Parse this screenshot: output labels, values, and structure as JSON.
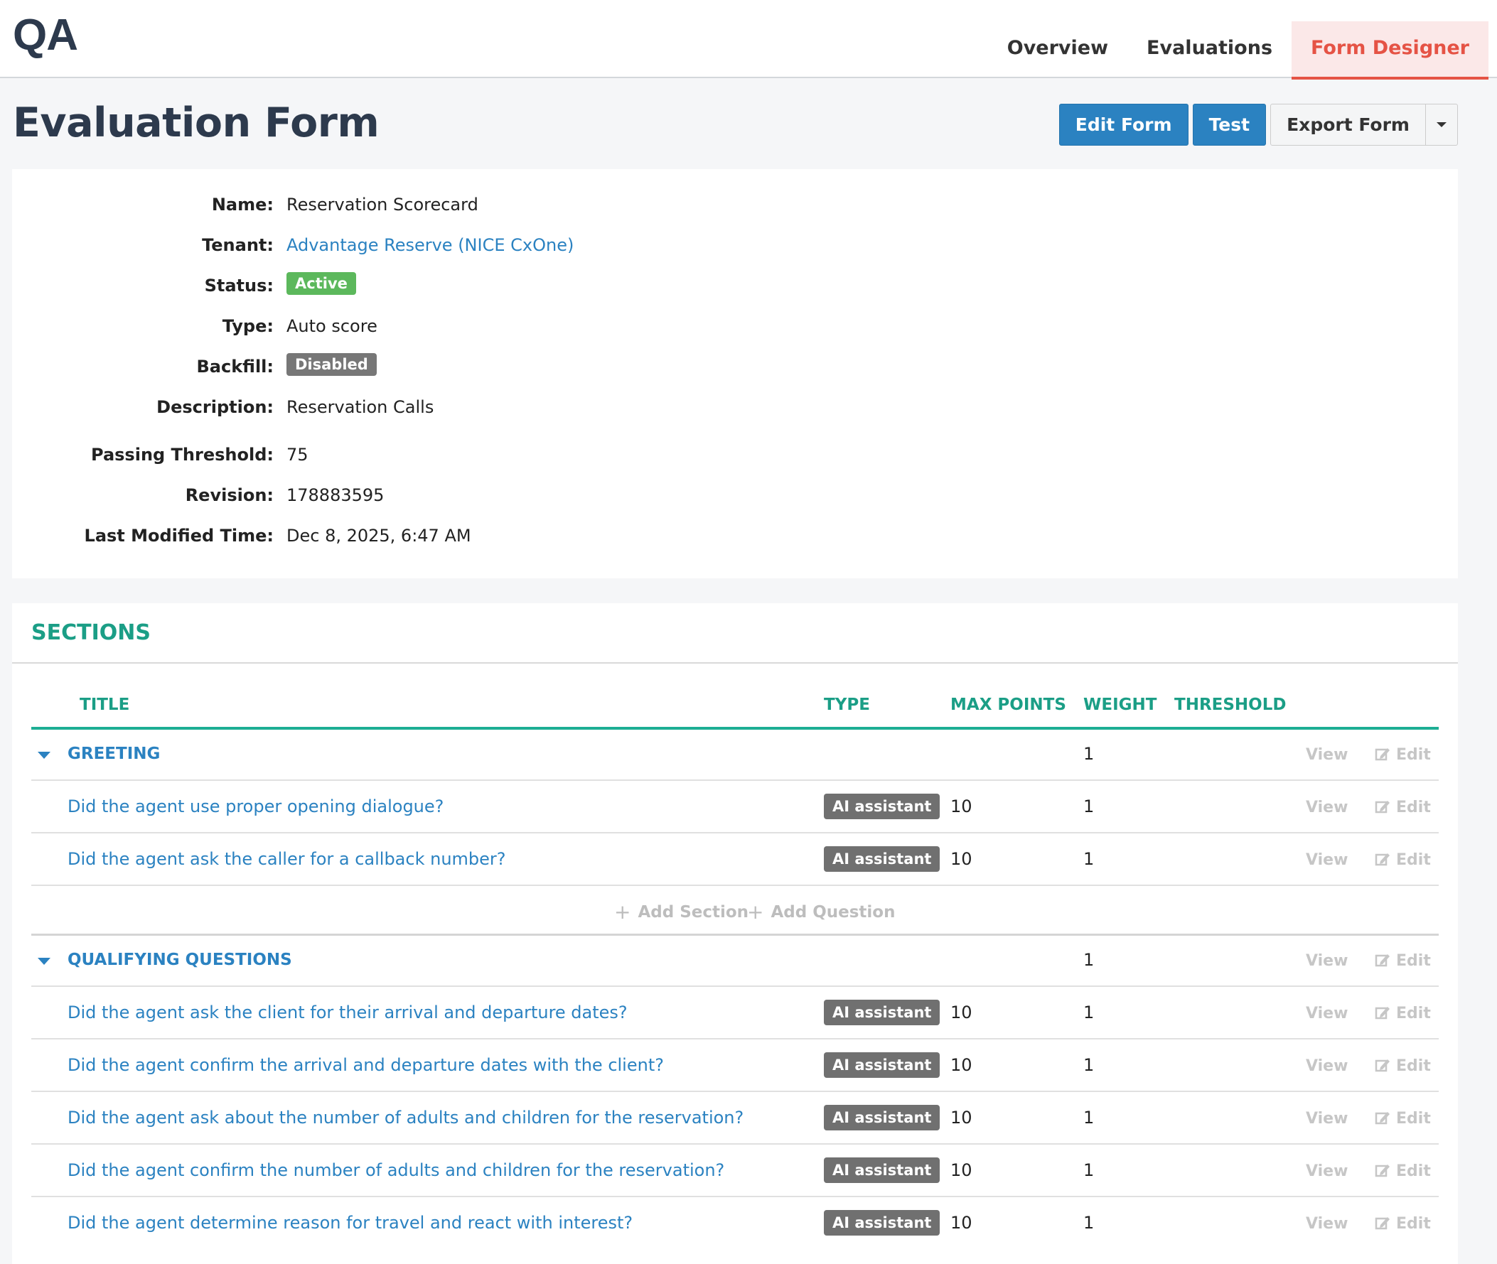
{
  "app": {
    "brand": "QA"
  },
  "nav": {
    "tabs": [
      {
        "label": "Overview"
      },
      {
        "label": "Evaluations"
      },
      {
        "label": "Form Designer"
      }
    ]
  },
  "page": {
    "title": "Evaluation Form"
  },
  "toolbar": {
    "edit_label": "Edit Form",
    "test_label": "Test",
    "export_label": "Export Form"
  },
  "details": {
    "name_label": "Name:",
    "name": "Reservation Scorecard",
    "tenant_label": "Tenant:",
    "tenant": "Advantage Reserve (NICE CxOne)",
    "status_label": "Status:",
    "status": "Active",
    "type_label": "Type:",
    "type": "Auto score",
    "backfill_label": "Backfill:",
    "backfill": "Disabled",
    "description_label": "Description:",
    "description": "Reservation Calls",
    "threshold_label": "Passing Threshold:",
    "threshold": "75",
    "revision_label": "Revision:",
    "revision": "178883595",
    "modified_label": "Last Modified Time:",
    "modified": "Dec 8, 2025, 6:47 AM"
  },
  "sections": {
    "heading": "SECTIONS",
    "columns": {
      "title": "TITLE",
      "type": "TYPE",
      "max_points": "MAX POINTS",
      "weight": "WEIGHT",
      "threshold": "THRESHOLD"
    },
    "view_label": "View",
    "edit_label": "Edit",
    "add_section_label": "Add Section",
    "add_question_label": "Add Question",
    "groups": [
      {
        "title": "GREETING",
        "weight": "1",
        "questions": [
          {
            "title": "Did the agent use proper opening dialogue?",
            "type": "AI assistant",
            "max_points": "10",
            "weight": "1"
          },
          {
            "title": "Did the agent ask the caller for a callback number?",
            "type": "AI assistant",
            "max_points": "10",
            "weight": "1"
          }
        ]
      },
      {
        "title": "QUALIFYING QUESTIONS",
        "weight": "1",
        "questions": [
          {
            "title": "Did the agent ask the client for their arrival and departure dates?",
            "type": "AI assistant",
            "max_points": "10",
            "weight": "1"
          },
          {
            "title": "Did the agent confirm the arrival and departure dates with the client?",
            "type": "AI assistant",
            "max_points": "10",
            "weight": "1"
          },
          {
            "title": "Did the agent ask about the number of adults and children for the reservation?",
            "type": "AI assistant",
            "max_points": "10",
            "weight": "1"
          },
          {
            "title": "Did the agent confirm the number of adults and children for the reservation?",
            "type": "AI assistant",
            "max_points": "10",
            "weight": "1"
          },
          {
            "title": "Did the agent determine reason for travel and react with interest?",
            "type": "AI assistant",
            "max_points": "10",
            "weight": "1"
          }
        ]
      }
    ]
  }
}
